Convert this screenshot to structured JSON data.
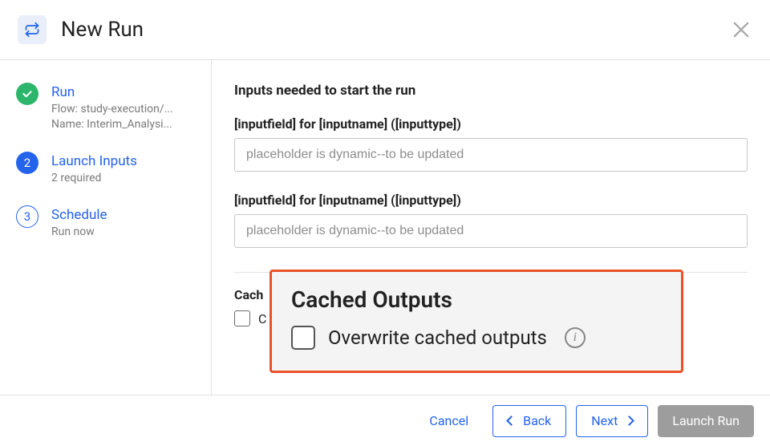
{
  "header": {
    "title": "New Run"
  },
  "sidebar": {
    "steps": [
      {
        "title": "Run",
        "sub1": "Flow: study-execution/...",
        "sub2": "Name: Interim_Analysi..."
      },
      {
        "number": "2",
        "title": "Launch Inputs",
        "sub1": "2 required"
      },
      {
        "number": "3",
        "title": "Schedule",
        "sub1": "Run now"
      }
    ]
  },
  "main": {
    "heading": "Inputs needed to start the run",
    "field1": {
      "label": "[inputfield] for [inputname] ([inputtype])",
      "placeholder": "placeholder is dynamic--to be updated"
    },
    "field2": {
      "label": "[inputfield] for [inputname] ([inputtype])",
      "placeholder": "placeholder is dynamic--to be updated"
    },
    "cached": {
      "section_label_truncated": "Cach",
      "checkbox_label_truncated": "C"
    }
  },
  "callout": {
    "title": "Cached Outputs",
    "checkbox_label": "Overwrite cached outputs"
  },
  "footer": {
    "cancel": "Cancel",
    "back": "Back",
    "next": "Next",
    "launch": "Launch Run"
  }
}
